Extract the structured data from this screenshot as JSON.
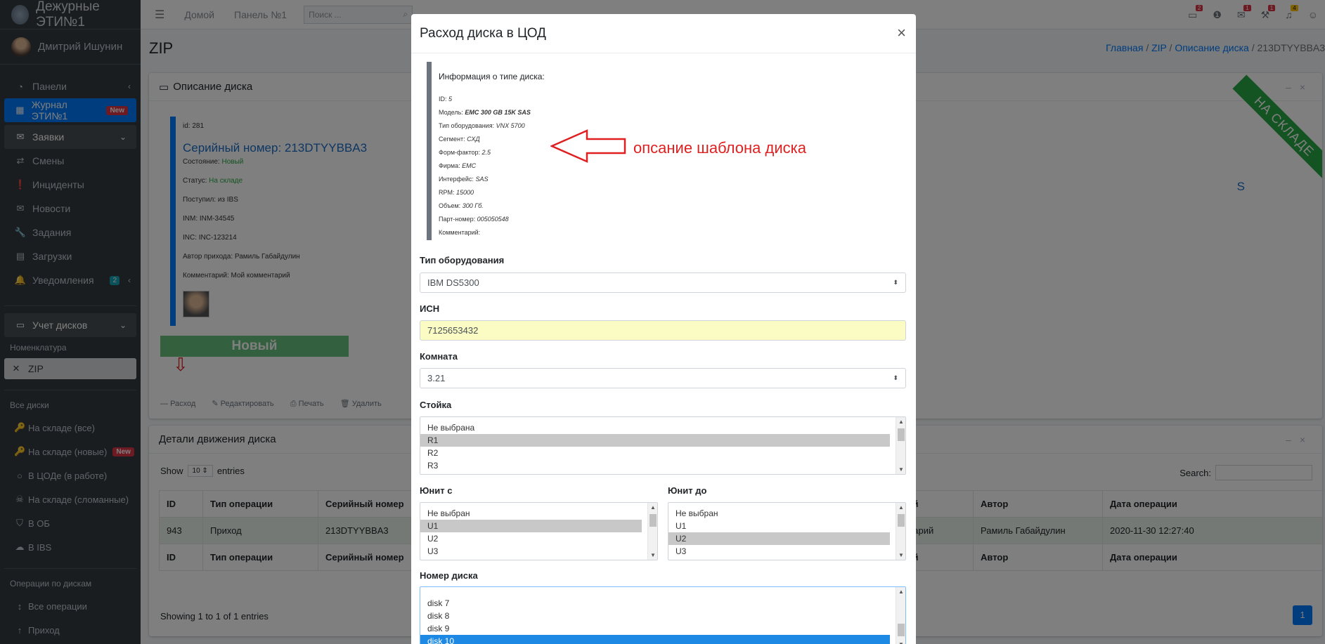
{
  "brand": {
    "title": "Дежурные ЭТИ№1"
  },
  "user": {
    "name": "Дмитрий Ишунин"
  },
  "sidebar": {
    "items": [
      {
        "label": "Панели",
        "icon": "dashboard-icon"
      },
      {
        "label": "Журнал ЭТИ№1",
        "badge": "New",
        "icon": "grid-icon"
      },
      {
        "label": "Заявки",
        "icon": "envelope-icon"
      },
      {
        "label": "Смены",
        "icon": "exchange-icon"
      },
      {
        "label": "Инциденты",
        "icon": "exclamation-icon"
      },
      {
        "label": "Новости",
        "icon": "envelope-open-icon"
      },
      {
        "label": "Задания",
        "icon": "wrench-icon"
      },
      {
        "label": "Загрузки",
        "icon": "file-icon"
      },
      {
        "label": "Уведомления",
        "count": "2",
        "icon": "bell-icon"
      }
    ],
    "disks_section": "Учет дисков",
    "nomenclature_header": "Номенклатура",
    "zip_item": "ZIP",
    "all_disks_header": "Все диски",
    "disk_items": [
      {
        "label": "На складе (все)"
      },
      {
        "label": "На складе (новые)",
        "badge": "New"
      },
      {
        "label": "В ЦОДе (в работе)"
      },
      {
        "label": "На складе (сломанные)"
      },
      {
        "label": "В ОБ"
      },
      {
        "label": "В IBS"
      }
    ],
    "ops_header": "Операции по дискам",
    "ops_items": [
      {
        "label": "Все операции"
      },
      {
        "label": "Приход"
      }
    ]
  },
  "topbar": {
    "home": "Домой",
    "panel": "Панель №1",
    "search_placeholder": "Поиск ...",
    "icon_counts": [
      "2",
      "",
      "1",
      "1",
      "4"
    ]
  },
  "page": {
    "title": "ZIP",
    "breadcrumb": [
      "Главная",
      "ZIP",
      "Описание диска",
      "213DTYYBBA3"
    ]
  },
  "disk_card": {
    "header": "Описание диска",
    "id_line": "id: 281",
    "serial": "Серийный номер: 213DTYYBBA3",
    "state_label": "Состояние:",
    "state_value": "Новый",
    "status_label": "Статус:",
    "status_value": "На складе",
    "received": "Поступил: из IBS",
    "inm": "INM: INM-34545",
    "inc": "INC: INC-123214",
    "author": "Автор прихода: Рамиль Габайдулин",
    "comment": "Комментарий: Мой комментарий",
    "state_button": "Новый",
    "ribbon": "НА СКЛАДЕ",
    "right_fragment": "S",
    "actions": [
      "Расход",
      "Редактировать",
      "Печать",
      "Удалить"
    ]
  },
  "movement_card": {
    "header": "Детали движения диска",
    "show": "Show",
    "entries_value": "10",
    "entries": "entries",
    "search_label": "Search:",
    "columns": [
      "ID",
      "Тип операции",
      "Серийный номер",
      "Комментарий",
      "Автор",
      "Дата операции"
    ],
    "rows": [
      [
        "943",
        "Приход",
        "213DTYYBBA3",
        "Мой комментарий",
        "Рамиль Габайдулин",
        "2020-11-30 12:27:40"
      ]
    ],
    "info": "Showing 1 to 1 of 1 entries",
    "page": "1"
  },
  "modal": {
    "title": "Расход диска в ЦОД",
    "close": "×",
    "info_title": "Информация о типе диска:",
    "info_lines": [
      {
        "label": "ID:",
        "value": "5"
      },
      {
        "label": "Модель:",
        "value": "EMC 300 GB 15K SAS",
        "bold": true
      },
      {
        "label": "Тип оборудования:",
        "value": "VNX 5700"
      },
      {
        "label": "Сегмент:",
        "value": "СХД"
      },
      {
        "label": "Форм-фактор:",
        "value": "2.5"
      },
      {
        "label": "Фирма:",
        "value": "EMC"
      },
      {
        "label": "Интерфейс:",
        "value": "SAS"
      },
      {
        "label": "RPM:",
        "value": "15000"
      },
      {
        "label": "Объем:",
        "value": "300 Гб."
      },
      {
        "label": "Парт-номер:",
        "value": "005050548"
      },
      {
        "label": "Комментарий:",
        "value": ""
      }
    ],
    "annotation": "опсание шаблона диска",
    "equipment_label": "Тип оборудования",
    "equipment_value": "IBM DS5300",
    "isn_label": "ИСН",
    "isn_value": "7125653432",
    "room_label": "Комната",
    "room_value": "3.21",
    "rack_label": "Стойка",
    "rack_options": [
      "Не выбрана",
      "R1",
      "R2",
      "R3"
    ],
    "unit_from_label": "Юнит с",
    "unit_from_options": [
      "Не выбран",
      "U1",
      "U2",
      "U3"
    ],
    "unit_to_label": "Юнит до",
    "unit_to_options": [
      "Не выбран",
      "U1",
      "U2",
      "U3"
    ],
    "disk_no_label": "Номер диска",
    "disk_no_options": [
      "disk 7",
      "disk 8",
      "disk 9",
      "disk 10"
    ]
  }
}
